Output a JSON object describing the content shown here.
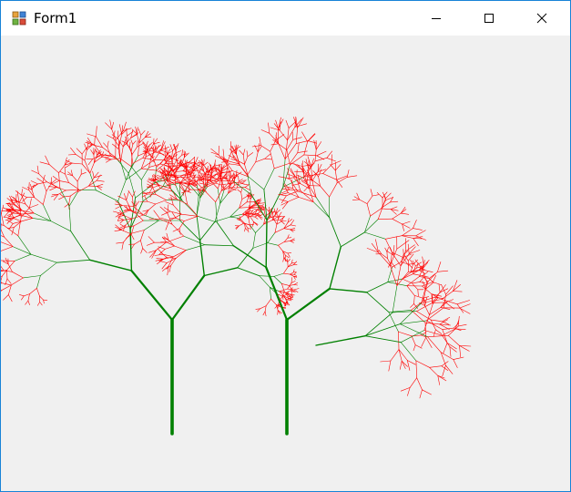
{
  "window": {
    "title": "Form1",
    "icon": "winforms-app-icon",
    "controls": [
      "minimize-icon",
      "maximize-icon",
      "close-icon"
    ]
  },
  "colors": {
    "client_background": "#f0f0f0",
    "trunk": "#008000",
    "leaves": "#ff0000",
    "border": "#1883d7"
  },
  "canvas": {
    "content": "fractal-trees"
  }
}
